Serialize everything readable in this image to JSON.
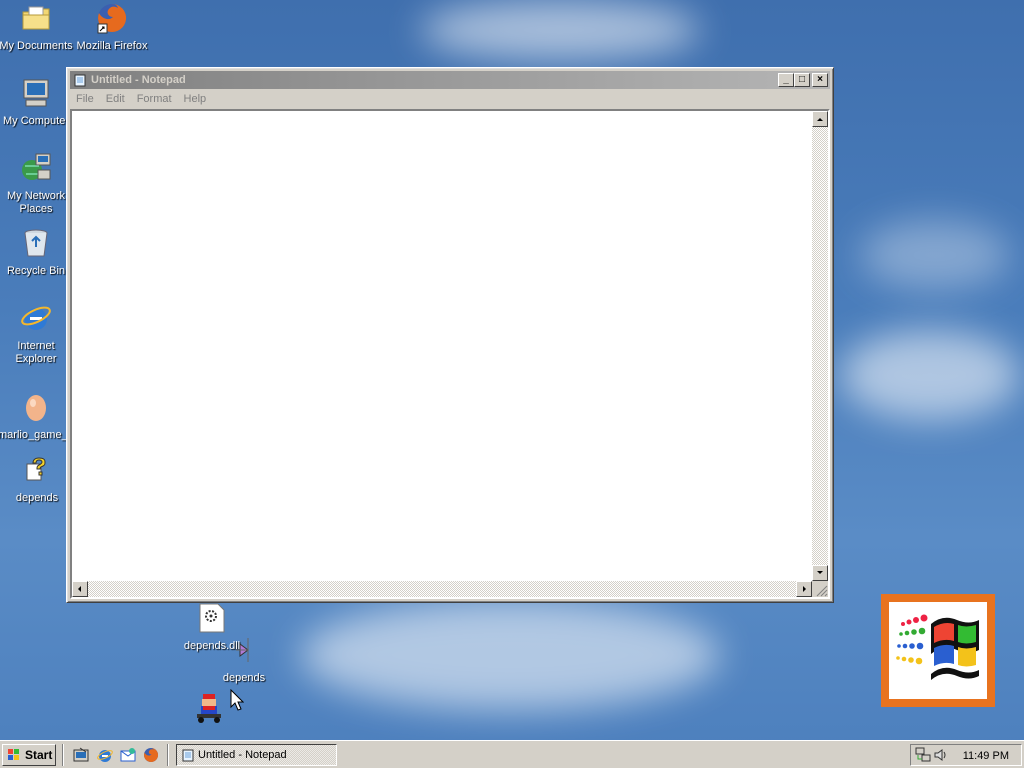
{
  "desktop": {
    "icons": [
      {
        "label": "My Documents",
        "icon": "folder-documents-icon"
      },
      {
        "label": "Mozilla Firefox",
        "icon": "firefox-icon"
      },
      {
        "label": "My Computer",
        "icon": "computer-icon"
      },
      {
        "label": "My Network Places",
        "icon": "network-icon"
      },
      {
        "label": "Recycle Bin",
        "icon": "recycle-bin-icon"
      },
      {
        "label": "Internet Explorer",
        "icon": "ie-icon"
      },
      {
        "label": "marlio_game_leaned",
        "icon": "egg-icon"
      },
      {
        "label": "depends",
        "icon": "help-icon"
      },
      {
        "label": "depends.dll",
        "icon": "dll-file-icon"
      },
      {
        "label": "depends",
        "icon": "depends-shortcut-icon"
      }
    ]
  },
  "notepad": {
    "title": "Untitled - Notepad",
    "menu": [
      "File",
      "Edit",
      "Format",
      "Help"
    ],
    "buttons": {
      "minimize": "_",
      "maximize": "□",
      "close": "×"
    },
    "content": ""
  },
  "taskbar": {
    "start_label": "Start",
    "task_label": "Untitled - Notepad",
    "clock": "11:49 PM"
  },
  "colors": {
    "desktop": "#3f6fae",
    "chrome": "#d4d0c8",
    "logo_frame": "#e8731f"
  }
}
